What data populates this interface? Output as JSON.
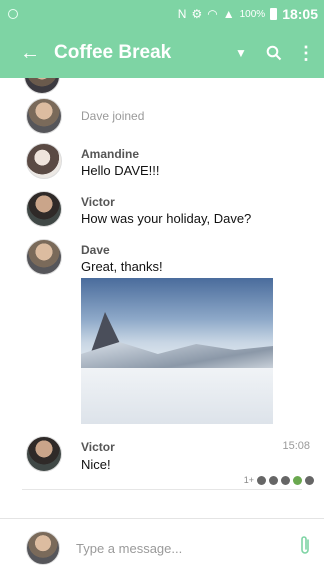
{
  "status_bar": {
    "battery_percent": "100%",
    "time": "18:05"
  },
  "app_bar": {
    "title": "Coffee Break"
  },
  "messages": [
    {
      "type": "event",
      "text": "Dave joined"
    },
    {
      "type": "message",
      "sender": "Amandine",
      "text": "Hello DAVE!!!"
    },
    {
      "type": "message",
      "sender": "Victor",
      "text": "How was your holiday, Dave?"
    },
    {
      "type": "message",
      "sender": "Dave",
      "text": "Great, thanks!"
    },
    {
      "type": "message",
      "sender": "Victor",
      "text": "Nice!",
      "timestamp": "15:08"
    }
  ],
  "read_receipts": {
    "count_label": "1+"
  },
  "composer": {
    "placeholder": "Type a message..."
  }
}
